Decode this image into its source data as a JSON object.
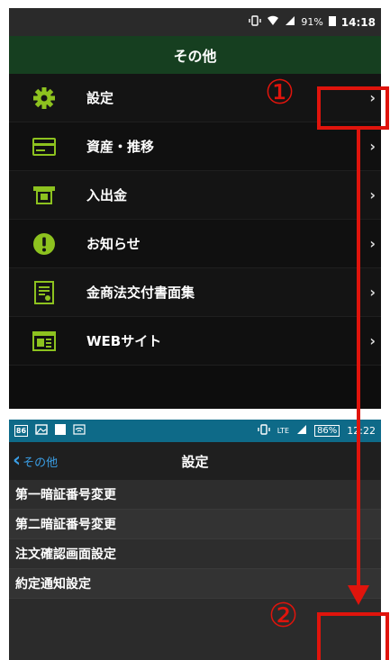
{
  "top_screen": {
    "status_bar": {
      "battery": "91%",
      "time": "14:18"
    },
    "title": "その他",
    "items": [
      {
        "label": "設定",
        "icon": "gear-icon",
        "chevron": "›"
      },
      {
        "label": "資産・推移",
        "icon": "card-icon",
        "chevron": "›"
      },
      {
        "label": "入出金",
        "icon": "atm-icon",
        "chevron": "›"
      },
      {
        "label": "お知らせ",
        "icon": "exclamation-icon",
        "chevron": "›"
      },
      {
        "label": "金商法交付書面集",
        "icon": "document-icon",
        "chevron": "›"
      },
      {
        "label": "WEBサイト",
        "icon": "website-icon",
        "chevron": "›"
      }
    ]
  },
  "bottom_screen": {
    "status_bar": {
      "notif_badge": "86",
      "network": "LTE",
      "battery": "86%",
      "time": "12:22"
    },
    "back_label": "その他",
    "title": "設定",
    "items": [
      {
        "label": "第一暗証番号変更",
        "chevron": "›"
      },
      {
        "label": "第二暗証番号変更",
        "chevron": "›"
      },
      {
        "label": "注文確認画面設定",
        "chevron": "›"
      },
      {
        "label": "約定通知設定",
        "chevron": "›"
      }
    ]
  },
  "annotations": {
    "step1": "①",
    "step2": "②"
  },
  "colors": {
    "accent_green": "#8dc21f",
    "header_green": "#163f20",
    "annotation_red": "#e0140c",
    "link_blue": "#3a9ee5"
  }
}
